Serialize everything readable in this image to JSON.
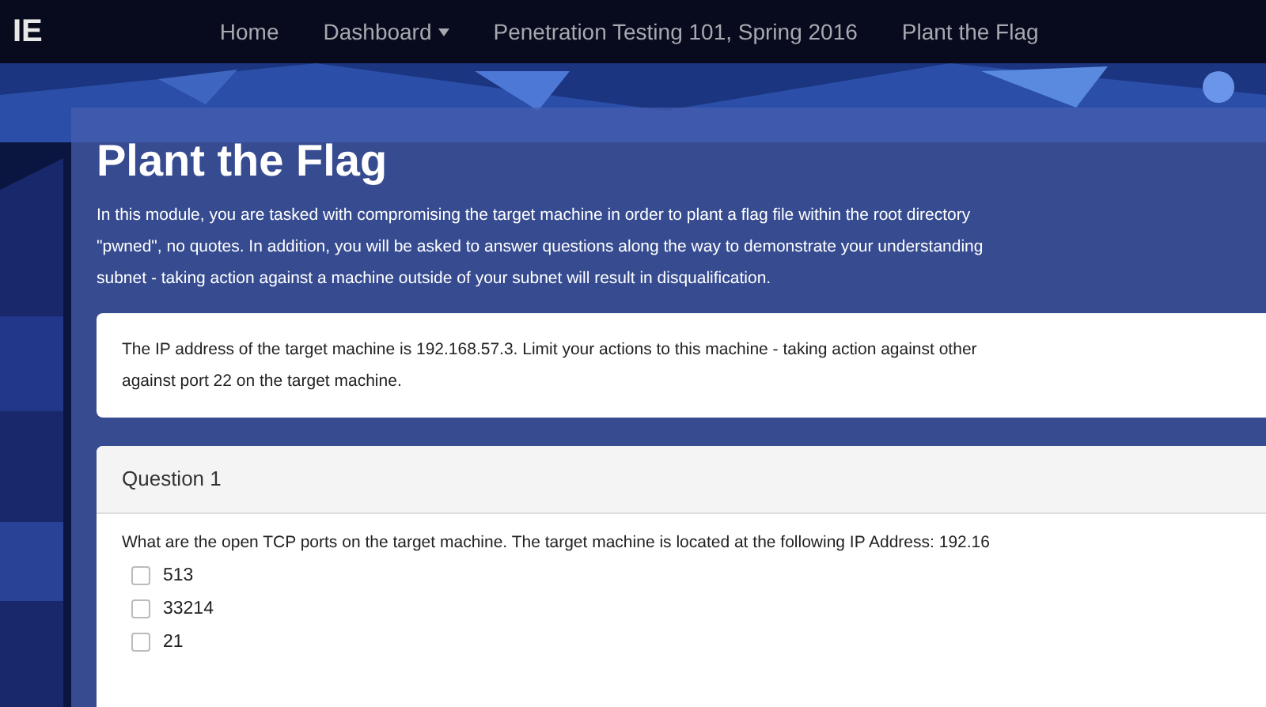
{
  "navbar": {
    "brand": "IE",
    "items": [
      {
        "label": "Home",
        "dropdown": false
      },
      {
        "label": "Dashboard",
        "dropdown": true
      },
      {
        "label": "Penetration Testing 101, Spring 2016",
        "dropdown": false
      },
      {
        "label": "Plant the Flag",
        "dropdown": false
      }
    ]
  },
  "header": {
    "title": "Plant the Flag",
    "intro_lines": [
      "In this module, you are tasked with compromising the target machine in order to plant a flag file within the root directory",
      "\"pwned\", no quotes. In addition, you will be asked to answer questions along the way to demonstrate your understanding",
      "subnet - taking action against a machine outside of your subnet will result in disqualification."
    ]
  },
  "notice_lines": [
    "The IP address of the target machine is 192.168.57.3. Limit your actions to this machine - taking action against other",
    "against port 22 on the target machine."
  ],
  "question": {
    "title": "Question 1",
    "prompt": "What are the open TCP ports on the target machine. The target machine is located at the following IP Address: 192.16",
    "options": [
      {
        "label": "513",
        "checked": false
      },
      {
        "label": "33214",
        "checked": false
      },
      {
        "label": "21",
        "checked": false
      }
    ]
  }
}
